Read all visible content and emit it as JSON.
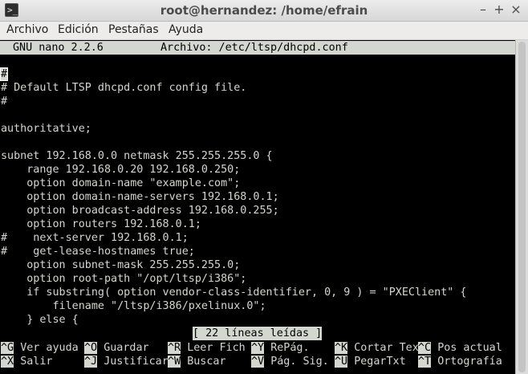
{
  "window": {
    "title": "root@hernandez: /home/efrain",
    "icon_glyph": ">_",
    "controls": {
      "minimize": "–",
      "maximize": "+",
      "close": "×"
    }
  },
  "menu": [
    "Archivo",
    "Edición",
    "Pestañas",
    "Ayuda"
  ],
  "nano": {
    "version": "GNU nano 2.2.6",
    "file": "Archivo: /etc/ltsp/dhcpd.conf",
    "cursor_char": "#",
    "lines": [
      "# Default LTSP dhcpd.conf config file.",
      "#",
      "",
      "authoritative;",
      "",
      "subnet 192.168.0.0 netmask 255.255.255.0 {",
      "    range 192.168.0.20 192.168.0.250;",
      "    option domain-name \"example.com\";",
      "    option domain-name-servers 192.168.0.1;",
      "    option broadcast-address 192.168.0.255;",
      "    option routers 192.168.0.1;",
      "#    next-server 192.168.0.1;",
      "#    get-lease-hostnames true;",
      "    option subnet-mask 255.255.255.0;",
      "    option root-path \"/opt/ltsp/i386\";",
      "    if substring( option vendor-class-identifier, 0, 9 ) = \"PXEClient\" {",
      "        filename \"/ltsp/i386/pxelinux.0\";",
      "    } else {"
    ],
    "status": "[ 22 líneas leídas ]",
    "shortcuts_row1": [
      {
        "key": "^G",
        "label": "Ver ayuda"
      },
      {
        "key": "^O",
        "label": "Guardar"
      },
      {
        "key": "^R",
        "label": "Leer Fich"
      },
      {
        "key": "^Y",
        "label": "RePág."
      },
      {
        "key": "^K",
        "label": "Cortar Tex"
      },
      {
        "key": "^C",
        "label": "Pos actual"
      }
    ],
    "shortcuts_row2": [
      {
        "key": "^X",
        "label": "Salir"
      },
      {
        "key": "^J",
        "label": "Justificar"
      },
      {
        "key": "^W",
        "label": "Buscar"
      },
      {
        "key": "^V",
        "label": "Pág. Sig."
      },
      {
        "key": "^U",
        "label": "PegarTxt"
      },
      {
        "key": "^T",
        "label": "Ortografía"
      }
    ]
  }
}
